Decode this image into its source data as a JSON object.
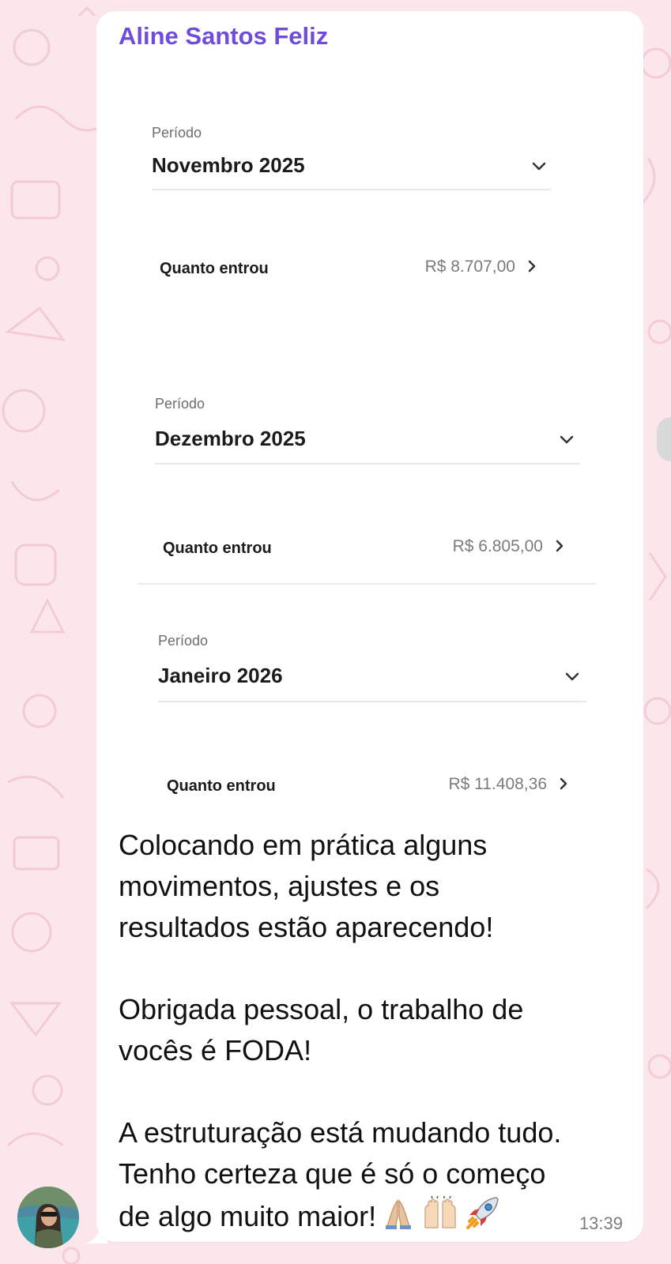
{
  "message": {
    "sender_name": "Aline Santos Feliz",
    "screenshot_content": {
      "sections": [
        {
          "period_label": "Período",
          "period_value": "Novembro 2025",
          "income_label": "Quanto entrou",
          "income_value": "R$ 8.707,00"
        },
        {
          "period_label": "Período",
          "period_value": "Dezembro 2025",
          "income_label": "Quanto entrou",
          "income_value": "R$ 6.805,00"
        },
        {
          "period_label": "Período",
          "period_value": "Janeiro 2026",
          "income_label": "Quanto entrou",
          "income_value": "R$ 11.408,36"
        }
      ]
    },
    "text_lines": [
      "Colocando em prática alguns",
      "movimentos, ajustes e os",
      "resultados estão aparecendo!",
      "",
      "Obrigada pessoal, o trabalho de",
      "vocês é FODA!",
      "",
      "A estruturação está mudando tudo.",
      "Tenho certeza que é só o começo",
      "de algo muito maior!"
    ],
    "emojis": [
      "folded-hands",
      "raising-hands",
      "rocket"
    ],
    "timestamp": "13:39"
  },
  "colors": {
    "chat_background": "#fbe6ec",
    "bubble_background": "#ffffff",
    "sender_name": "#6f4cdb",
    "timestamp": "#7d7d7d"
  }
}
